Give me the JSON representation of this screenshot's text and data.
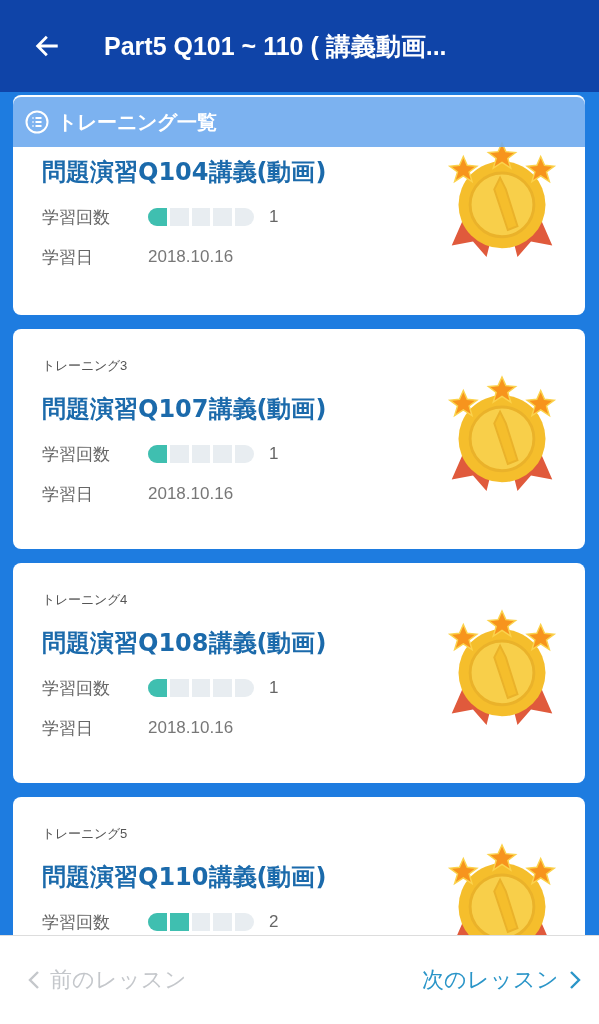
{
  "header": {
    "title": "Part5 Q101 ~ 110 ( 講義動画..."
  },
  "list_header": {
    "label": "トレーニング一覧"
  },
  "trainings": [
    {
      "title": "問題演習Q104講義(動画)",
      "count_label": "学習回数",
      "level": 0.2,
      "count": "1",
      "date_label": "学習日",
      "date": "2018.10.16"
    },
    {
      "label": "トレーニング3",
      "title": "問題演習Q107講義(動画)",
      "count_label": "学習回数",
      "level": 0.2,
      "count": "1",
      "date_label": "学習日",
      "date": "2018.10.16"
    },
    {
      "label": "トレーニング4",
      "title": "問題演習Q108講義(動画)",
      "count_label": "学習回数",
      "level": 0.2,
      "count": "1",
      "date_label": "学習日",
      "date": "2018.10.16"
    },
    {
      "label": "トレーニング5",
      "title": "問題演習Q110講義(動画)",
      "count_label": "学習回数",
      "level": 0.4,
      "count": "2"
    }
  ],
  "nav": [
    {
      "kind": "prev",
      "label": "前のレッスン",
      "disabled": true
    },
    {
      "kind": "next",
      "label": "次のレッスン",
      "disabled": false
    }
  ]
}
